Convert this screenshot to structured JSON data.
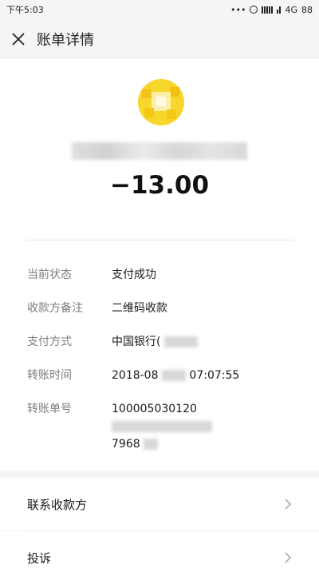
{
  "status_bar": {
    "time": "下午5:03",
    "dots": "•••",
    "network": "4G",
    "battery": "88"
  },
  "header": {
    "title": "账单详情",
    "close_icon": "close-icon"
  },
  "summary": {
    "avatar_icon": "merchant-avatar-icon",
    "amount": "−13.00"
  },
  "details": [
    {
      "label": "当前状态",
      "value": "支付成功"
    },
    {
      "label": "收款方备注",
      "value": "二维码收款"
    },
    {
      "label": "支付方式",
      "value": "中国银行("
    },
    {
      "label": "转账时间",
      "value_a": "2018-08",
      "value_b": "07:07:55"
    },
    {
      "label": "转账单号",
      "value_a": "100005030120",
      "value_b": "7968"
    }
  ],
  "actions": [
    {
      "label": "联系收款方",
      "icon": "chevron-right-icon"
    },
    {
      "label": "投诉",
      "icon": "chevron-right-icon"
    }
  ]
}
